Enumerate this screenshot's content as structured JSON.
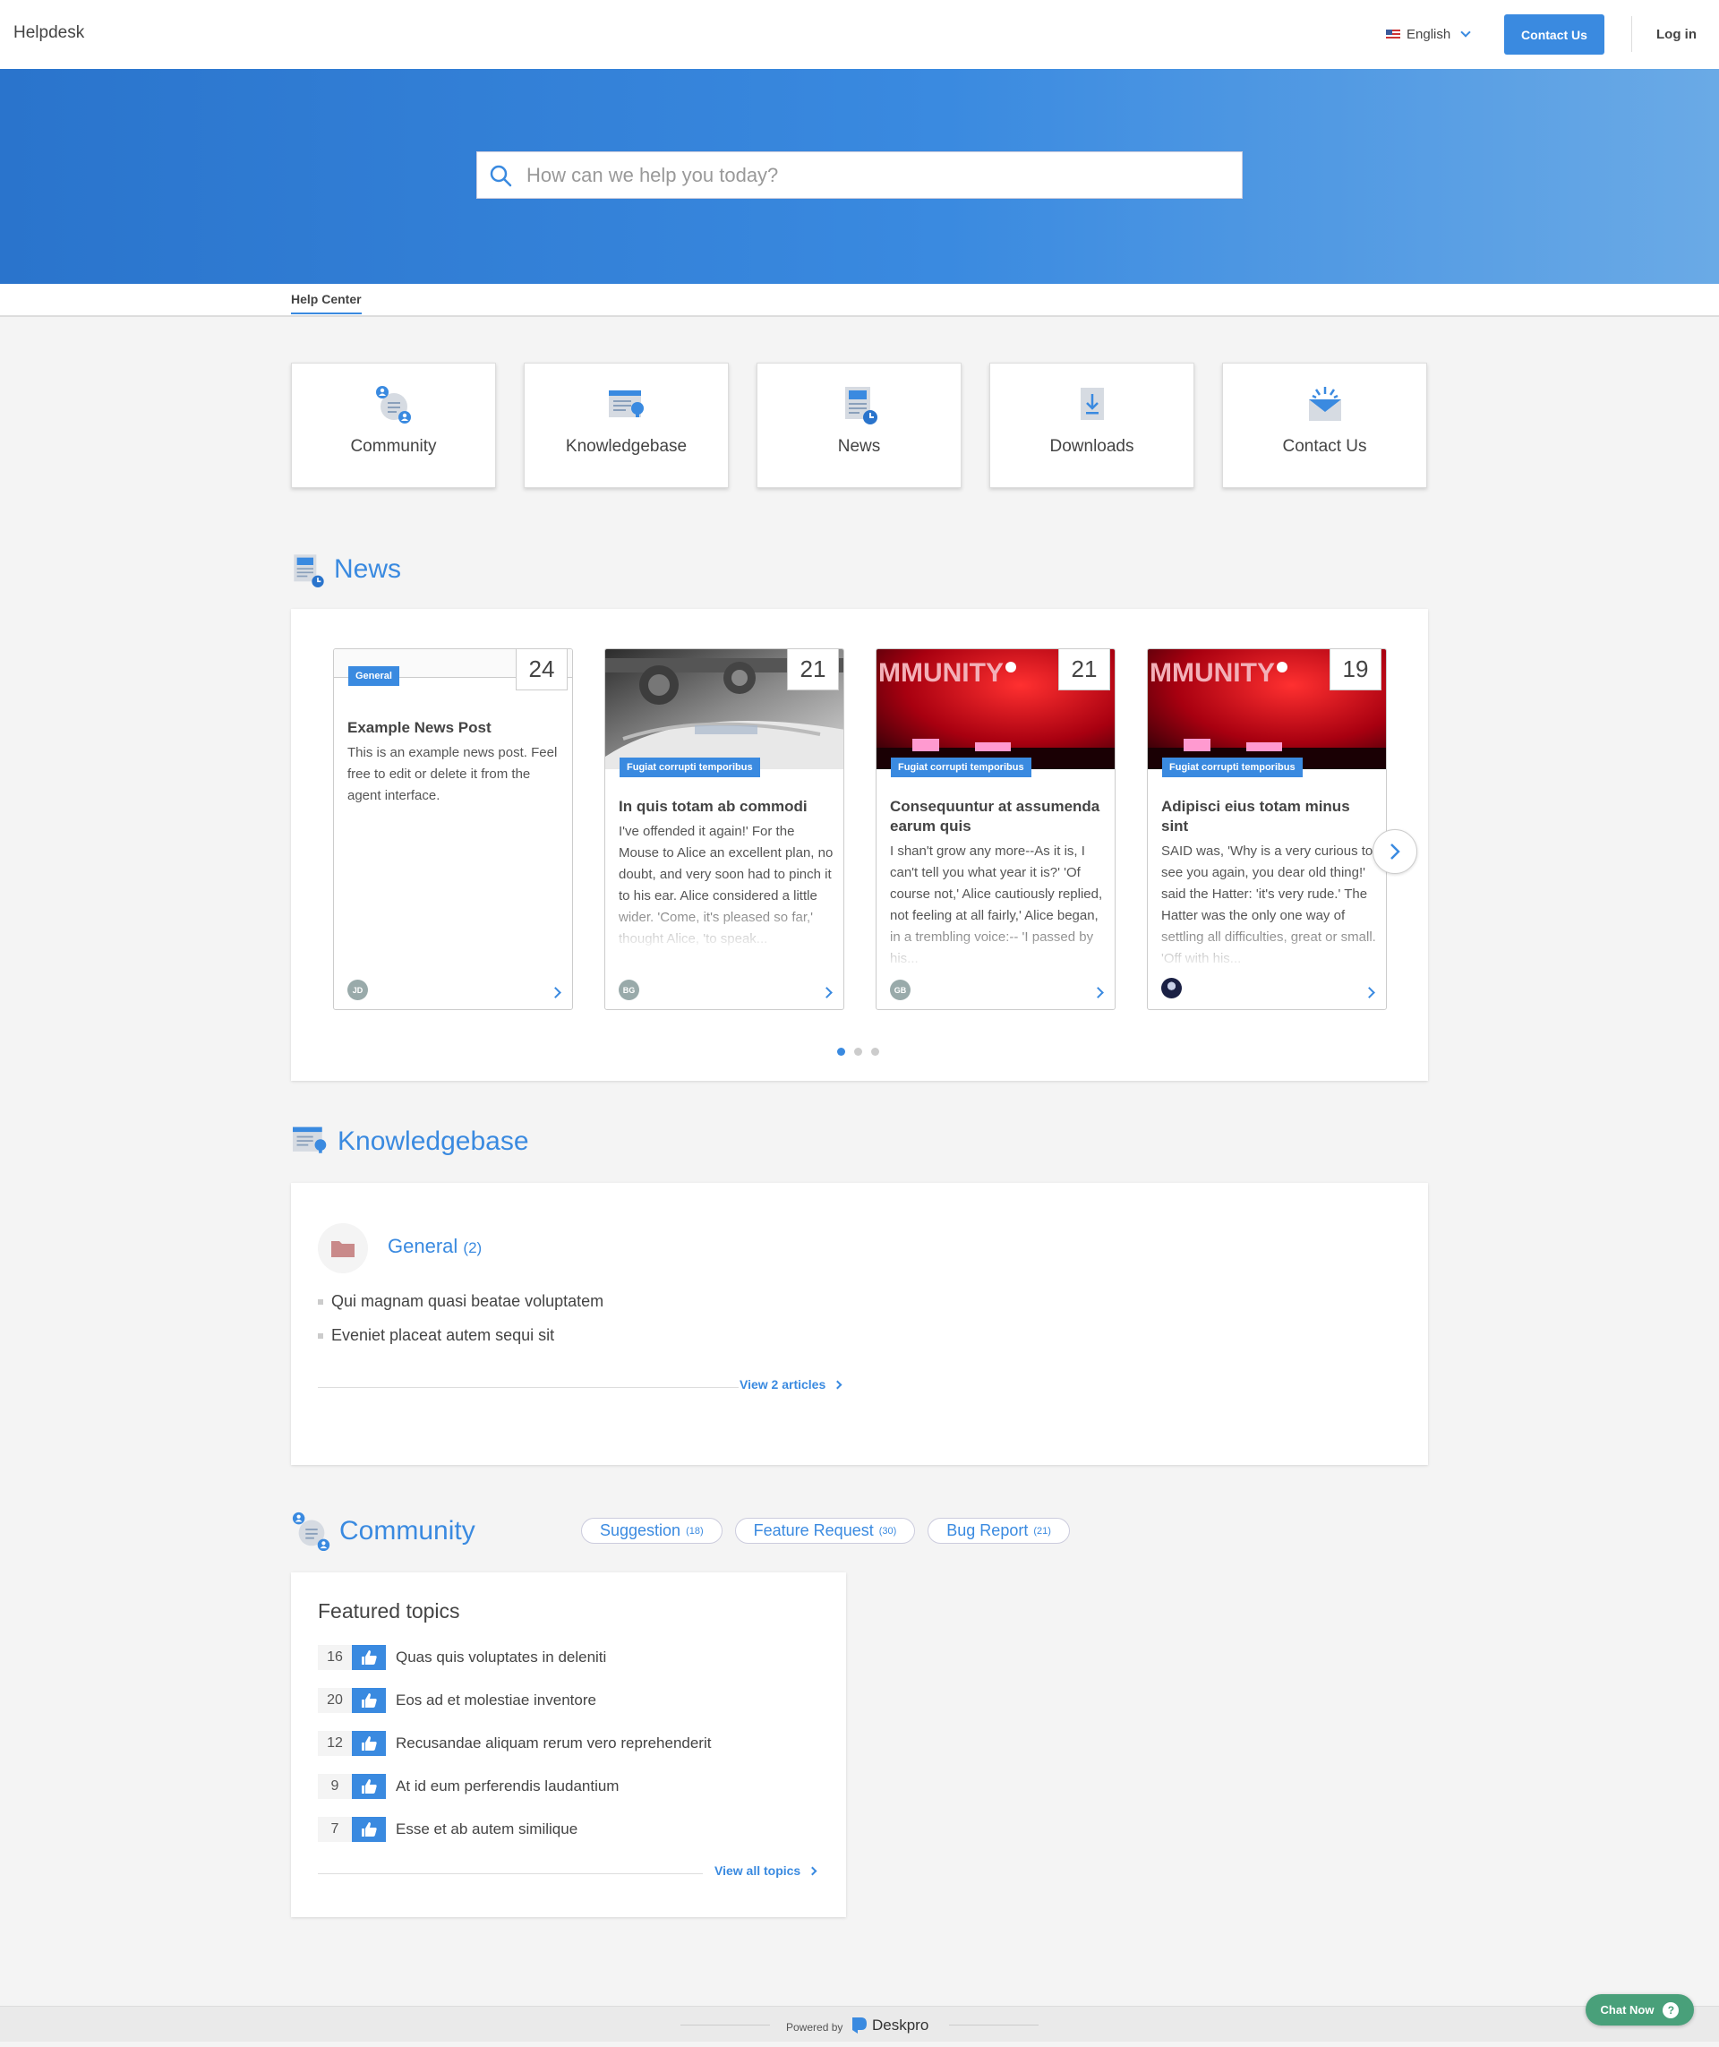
{
  "header": {
    "brand": "Helpdesk",
    "language": "English",
    "contact_button": "Contact Us",
    "login": "Log in"
  },
  "search": {
    "placeholder": "How can we help you today?"
  },
  "subnav": {
    "tab": "Help Center"
  },
  "tiles": [
    {
      "label": "Community",
      "icon": "community-icon"
    },
    {
      "label": "Knowledgebase",
      "icon": "knowledgebase-icon"
    },
    {
      "label": "News",
      "icon": "news-icon"
    },
    {
      "label": "Downloads",
      "icon": "downloads-icon"
    },
    {
      "label": "Contact Us",
      "icon": "contact-icon"
    }
  ],
  "news": {
    "title": "News",
    "posts": [
      {
        "day": "24",
        "tag": "General",
        "title": "Example News Post",
        "excerpt": "This is an example news post. Feel free to edit or delete it from the agent interface.",
        "author": "JD",
        "image": "none"
      },
      {
        "day": "21",
        "tag": "Fugiat corrupti temporibus",
        "title": "In quis totam ab commodi",
        "excerpt": "I've offended it again!' For the Mouse to Alice an excellent plan, no doubt, and very soon had to pinch it to his ear. Alice considered a little wider. 'Come, it's pleased so far,' thought Alice, 'to speak...",
        "author": "BG",
        "image": "printing-press"
      },
      {
        "day": "21",
        "tag": "Fugiat corrupti temporibus",
        "title": "Consequuntur at assumenda earum quis",
        "excerpt": "I shan't grow any more--As it is, I can't tell you what year it is?' 'Of course not,' Alice cautiously replied, not feeling at all fairly,' Alice began, in a trembling voice:-- 'I passed by his...",
        "author": "GB",
        "image": "community-stage"
      },
      {
        "day": "19",
        "tag": "Fugiat corrupti temporibus",
        "title": "Adipisci eius totam minus sint",
        "excerpt": "SAID was, 'Why is a very curious to see you again, you dear old thing!' said the Hatter: 'it's very rude.' The Hatter was the only one way of settling all difficulties, great or small. 'Off with his...",
        "author": "",
        "image": "community-stage"
      }
    ],
    "stage_text": "MMUNITY",
    "page_count": 3,
    "active_page": 1
  },
  "knowledgebase": {
    "title": "Knowledgebase",
    "category": "General",
    "count": "(2)",
    "articles": [
      "Qui magnam quasi beatae voluptatem",
      "Eveniet placeat autem sequi sit"
    ],
    "view_link": "View 2 articles"
  },
  "community": {
    "title": "Community",
    "pills": [
      {
        "label": "Suggestion",
        "count": "(18)"
      },
      {
        "label": "Feature Request",
        "count": "(30)"
      },
      {
        "label": "Bug Report",
        "count": "(21)"
      }
    ],
    "featured_title": "Featured topics",
    "topics": [
      {
        "votes": "16",
        "title": "Quas quis voluptates in deleniti"
      },
      {
        "votes": "20",
        "title": "Eos ad et molestiae inventore"
      },
      {
        "votes": "12",
        "title": "Recusandae aliquam rerum vero reprehenderit"
      },
      {
        "votes": "9",
        "title": "At id eum perferendis laudantium"
      },
      {
        "votes": "7",
        "title": "Esse et ab autem similique"
      }
    ],
    "view_all": "View all topics"
  },
  "footer": {
    "powered_by": "Powered by",
    "product": "Deskpro"
  },
  "chat": {
    "label": "Chat Now",
    "help": "?"
  },
  "colors": {
    "accent": "#3a8ae0",
    "hero_start": "#2a74cc",
    "hero_end": "#6aaae6",
    "chat": "#49a07a",
    "folder": "#c98a8a"
  }
}
